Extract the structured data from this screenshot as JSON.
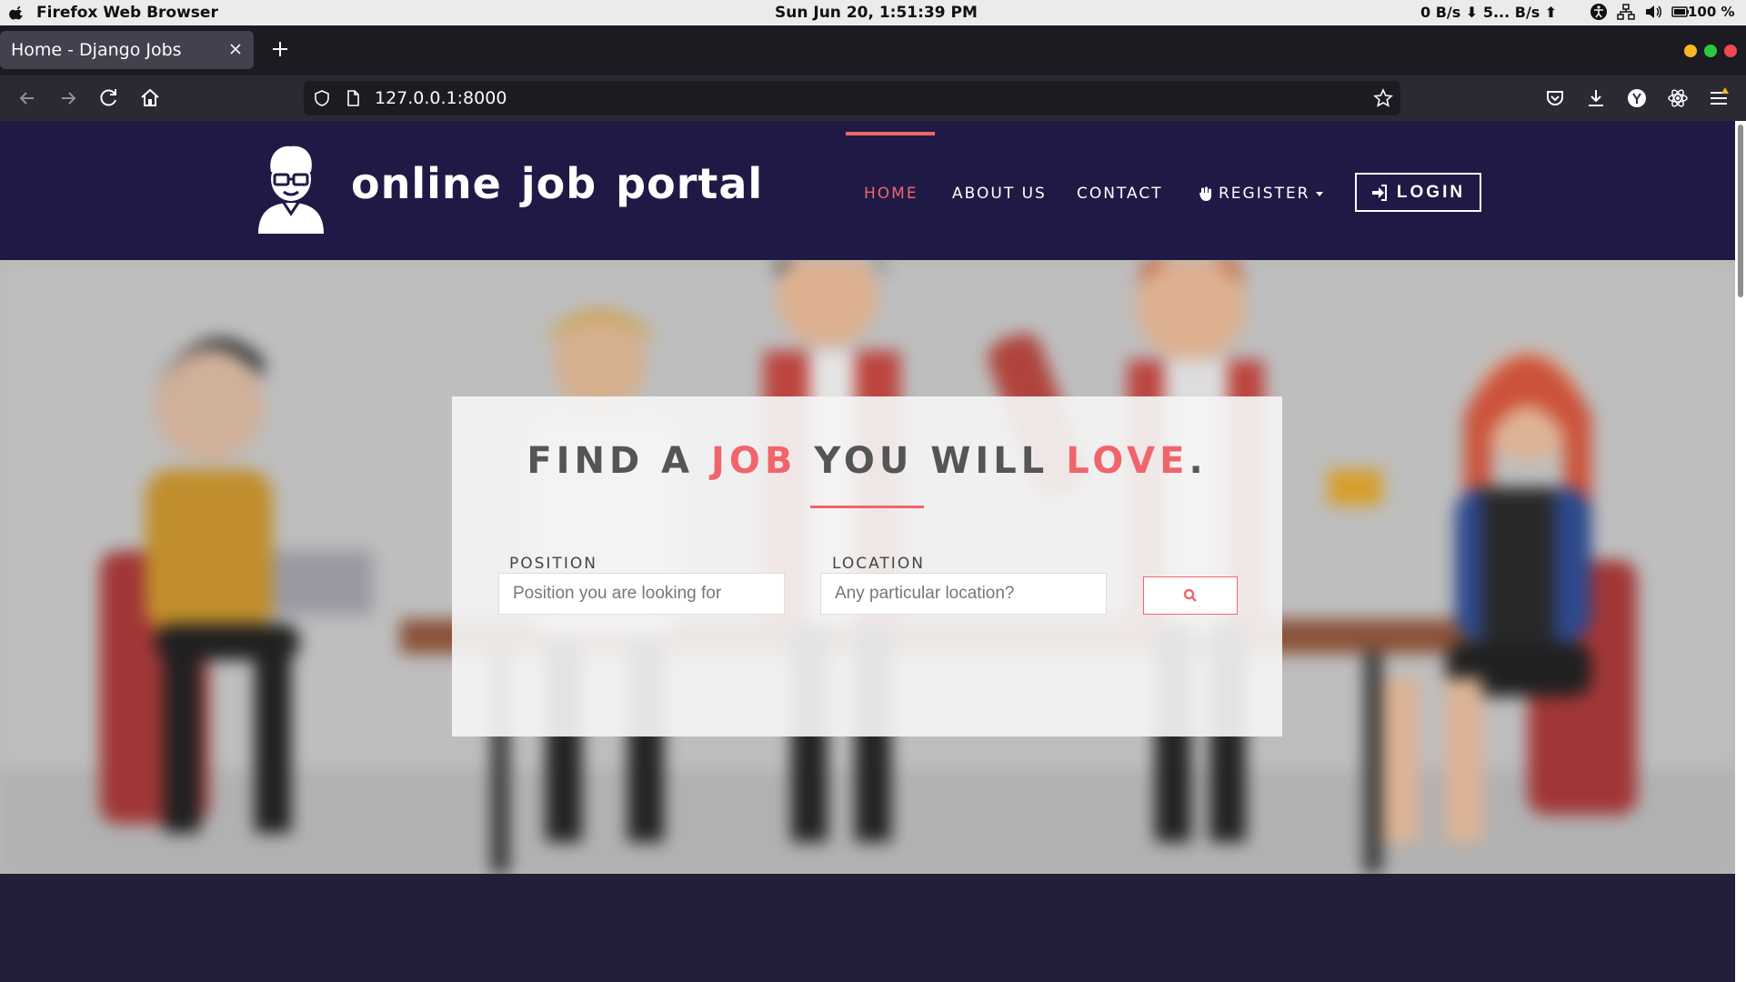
{
  "os_bar": {
    "app_name": "Firefox Web Browser",
    "clock": "Sun Jun 20,  1:51:39 PM",
    "network": "0 B/s  ⬇  5... B/s  ⬆",
    "battery": "100 %"
  },
  "browser": {
    "tab_title": "Home - Django Jobs",
    "url": "127.0.0.1:8000"
  },
  "site": {
    "logo_text": "online job portal",
    "nav": {
      "home": "HOME",
      "about": "ABOUT US",
      "contact": "CONTACT",
      "register": "REGISTER",
      "login": "LOGIN"
    },
    "hero": {
      "headline_1": "FIND A ",
      "headline_job": "JOB",
      "headline_2": " YOU WILL ",
      "headline_love": "LOVE",
      "headline_end": ".",
      "position_label": "POSITION",
      "position_placeholder": "Position you are looking for",
      "location_label": "LOCATION",
      "location_placeholder": "Any particular location?"
    }
  },
  "colors": {
    "accent": "#f0656c",
    "header_bg": "#1f1a45",
    "footer_bg": "#231f3a"
  }
}
